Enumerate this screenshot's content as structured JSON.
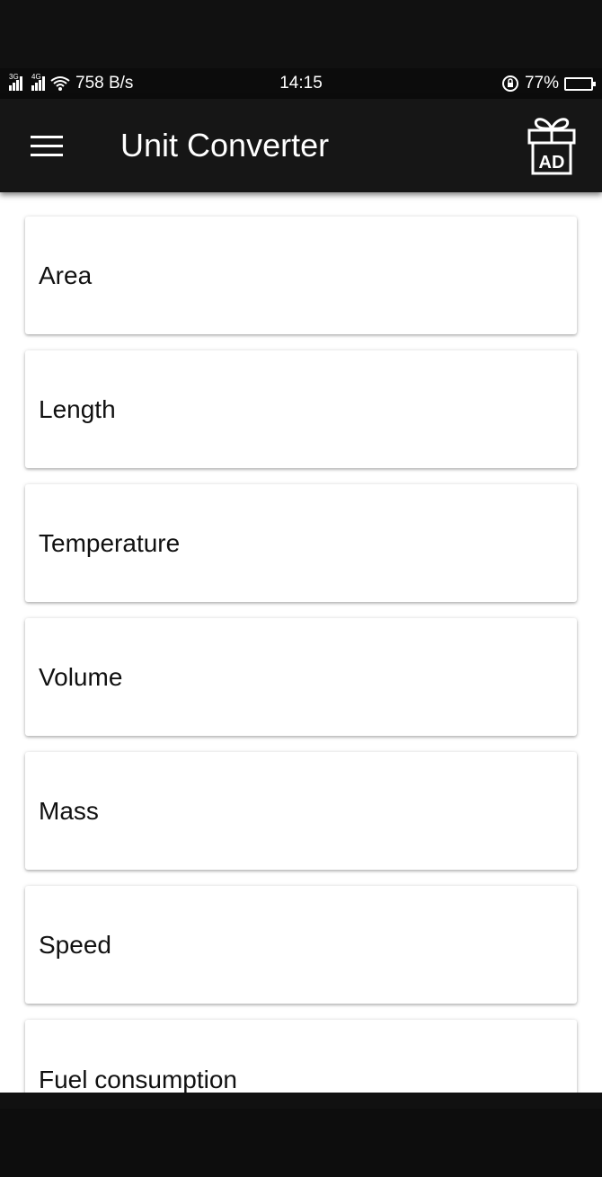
{
  "status_bar": {
    "net_speed": "758 B/s",
    "time": "14:15",
    "battery_percent": "77%",
    "battery_level": 0.77,
    "network_tags": [
      "3G",
      "4G"
    ]
  },
  "app_bar": {
    "title": "Unit Converter",
    "ad_label": "AD",
    "icons": [
      "menu-icon",
      "gift-ad-icon"
    ]
  },
  "categories": [
    {
      "label": "Area"
    },
    {
      "label": "Length"
    },
    {
      "label": "Temperature"
    },
    {
      "label": "Volume"
    },
    {
      "label": "Mass"
    },
    {
      "label": "Speed"
    },
    {
      "label": "Fuel consumption"
    }
  ],
  "colors": {
    "app_bar": "#161616",
    "background": "#ffffff",
    "battery_fill": "#2b8be8"
  }
}
